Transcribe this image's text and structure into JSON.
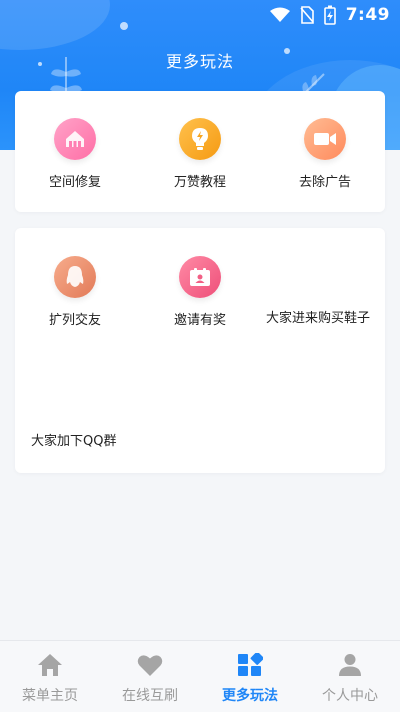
{
  "status": {
    "time": "7:49"
  },
  "header": {
    "title": "更多玩法"
  },
  "card1": {
    "items": [
      {
        "label": "空间修复",
        "icon": "house-icon",
        "color": "#ff7fb3"
      },
      {
        "label": "万赞教程",
        "icon": "lightbulb-icon",
        "color": "#f7a623"
      },
      {
        "label": "去除广告",
        "icon": "video-icon",
        "color": "#ff9a6e"
      }
    ]
  },
  "card2": {
    "items": [
      {
        "label": "扩列交友",
        "icon": "qq-penguin-icon",
        "color": "#f0926c"
      },
      {
        "label": "邀请有奖",
        "icon": "gift-card-icon",
        "color": "#f25f85"
      }
    ],
    "text_links": [
      "大家进来购买鞋子",
      "大家加下QQ群"
    ]
  },
  "tabbar": {
    "tabs": [
      {
        "label": "菜单主页",
        "icon": "home-icon"
      },
      {
        "label": "在线互刷",
        "icon": "heart-icon"
      },
      {
        "label": "更多玩法",
        "icon": "grid-icon",
        "active": true
      },
      {
        "label": "个人中心",
        "icon": "person-icon"
      }
    ],
    "active_color": "#1f86f7",
    "inactive_color": "#9a9a9a"
  }
}
